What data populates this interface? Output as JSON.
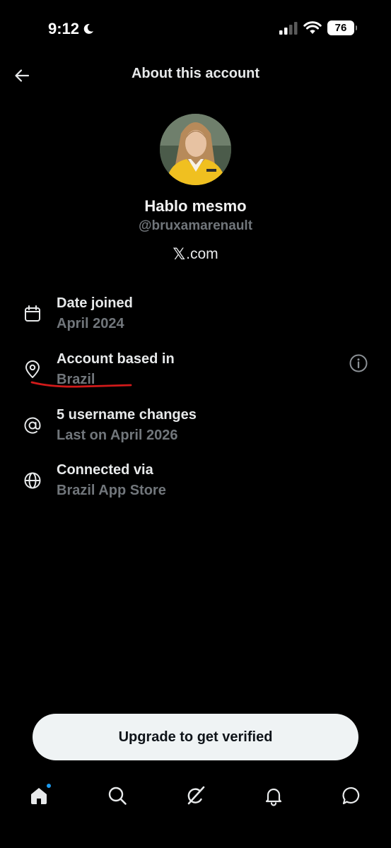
{
  "status_bar": {
    "time": "9:12",
    "battery": "76",
    "icons": [
      "moon-icon",
      "cellular-signal-icon",
      "wifi-icon",
      "battery-icon"
    ]
  },
  "header": {
    "title": "About this account",
    "back_icon": "arrow-left-icon"
  },
  "profile": {
    "display_name": "Hablo mesmo",
    "handle": "@bruxamarenault",
    "website_mark": "𝕏",
    "website_suffix": ".com"
  },
  "info": [
    {
      "icon": "calendar-icon",
      "label": "Date joined",
      "value": "April 2024"
    },
    {
      "icon": "location-pin-icon",
      "label": "Account based in",
      "value": "Brazil",
      "action_icon": "info-circle-icon",
      "annotation": "red-underline"
    },
    {
      "icon": "at-sign-icon",
      "label": "5 username changes",
      "value": "Last on April 2026"
    },
    {
      "icon": "globe-icon",
      "label": "Connected via",
      "value": "Brazil App Store"
    }
  ],
  "upgrade": {
    "label": "Upgrade to get verified"
  },
  "tab_bar": {
    "items": [
      {
        "icon": "home-icon",
        "active": true,
        "badge": true
      },
      {
        "icon": "search-icon"
      },
      {
        "icon": "grok-icon"
      },
      {
        "icon": "bell-icon"
      },
      {
        "icon": "messages-icon"
      }
    ]
  },
  "colors": {
    "background": "#000000",
    "primary_text": "#e7e9ea",
    "secondary_text": "#71767b",
    "accent": "#1d9bf0",
    "annotation": "#d11a1a",
    "button_bg": "#eff3f4"
  }
}
